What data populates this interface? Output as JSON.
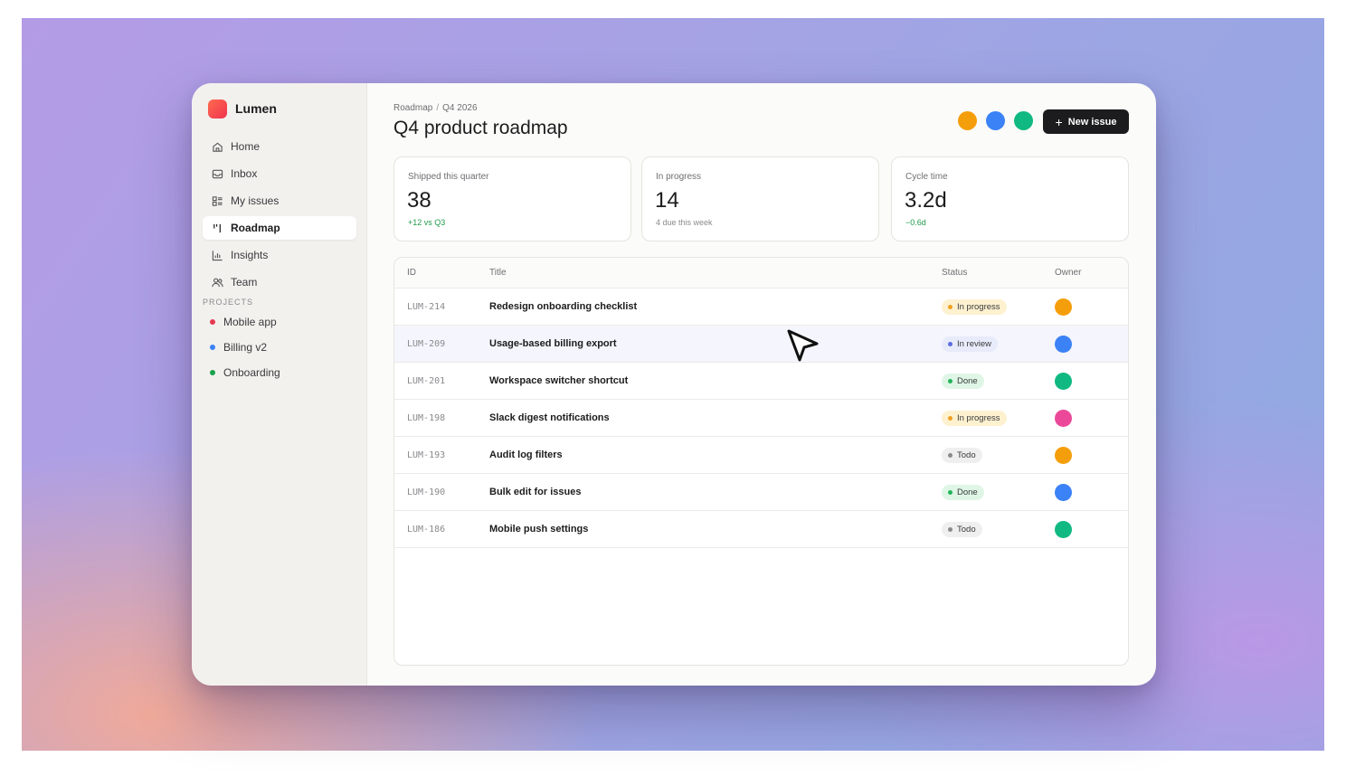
{
  "app": {
    "name": "Lumen",
    "brand_color": "#f0334f"
  },
  "sidebar": {
    "nav": [
      {
        "label": "Home",
        "icon": "home-icon"
      },
      {
        "label": "Inbox",
        "icon": "inbox-icon"
      },
      {
        "label": "My issues",
        "icon": "list-icon"
      },
      {
        "label": "Roadmap",
        "icon": "roadmap-icon",
        "active": true
      },
      {
        "label": "Insights",
        "icon": "chart-icon"
      },
      {
        "label": "Team",
        "icon": "team-icon"
      }
    ],
    "projects_label": "PROJECTS",
    "projects": [
      {
        "label": "Mobile app",
        "color": "#e5394f"
      },
      {
        "label": "Billing v2",
        "color": "#3b82f6"
      },
      {
        "label": "Onboarding",
        "color": "#16a34a"
      }
    ]
  },
  "header": {
    "breadcrumb": [
      "Roadmap",
      "Q4 2026"
    ],
    "breadcrumb_separator": "/",
    "title": "Q4 product roadmap",
    "avatars": [
      "#f59e0b",
      "#3b82f6",
      "#10b981"
    ],
    "new_issue_icon": "+",
    "new_issue_label": "New issue"
  },
  "stats": [
    {
      "label": "Shipped this quarter",
      "value": "38",
      "note": "+12 vs Q3",
      "note_positive": true
    },
    {
      "label": "In progress",
      "value": "14",
      "note": "4 due this week",
      "note_positive": false
    },
    {
      "label": "Cycle time",
      "value": "3.2d",
      "note": "−0.6d",
      "note_positive": true
    }
  ],
  "table": {
    "columns": [
      "ID",
      "Title",
      "Status",
      "Owner"
    ],
    "rows": [
      {
        "id": "LUM-214",
        "title": "Redesign onboarding checklist",
        "status": "In progress",
        "status_kind": "inprogress",
        "owner_color": "#f59e0b"
      },
      {
        "id": "LUM-209",
        "title": "Usage-based billing export",
        "status": "In review",
        "status_kind": "inreview",
        "owner_color": "#3b82f6",
        "hovered": true
      },
      {
        "id": "LUM-201",
        "title": "Workspace switcher shortcut",
        "status": "Done",
        "status_kind": "done",
        "owner_color": "#10b981"
      },
      {
        "id": "LUM-198",
        "title": "Slack digest notifications",
        "status": "In progress",
        "status_kind": "inprogress",
        "owner_color": "#ec4899"
      },
      {
        "id": "LUM-193",
        "title": "Audit log filters",
        "status": "Todo",
        "status_kind": "todo",
        "owner_color": "#f59e0b"
      },
      {
        "id": "LUM-190",
        "title": "Bulk edit for issues",
        "status": "Done",
        "status_kind": "done",
        "owner_color": "#3b82f6"
      },
      {
        "id": "LUM-186",
        "title": "Mobile push settings",
        "status": "Todo",
        "status_kind": "todo",
        "owner_color": "#10b981"
      }
    ]
  }
}
